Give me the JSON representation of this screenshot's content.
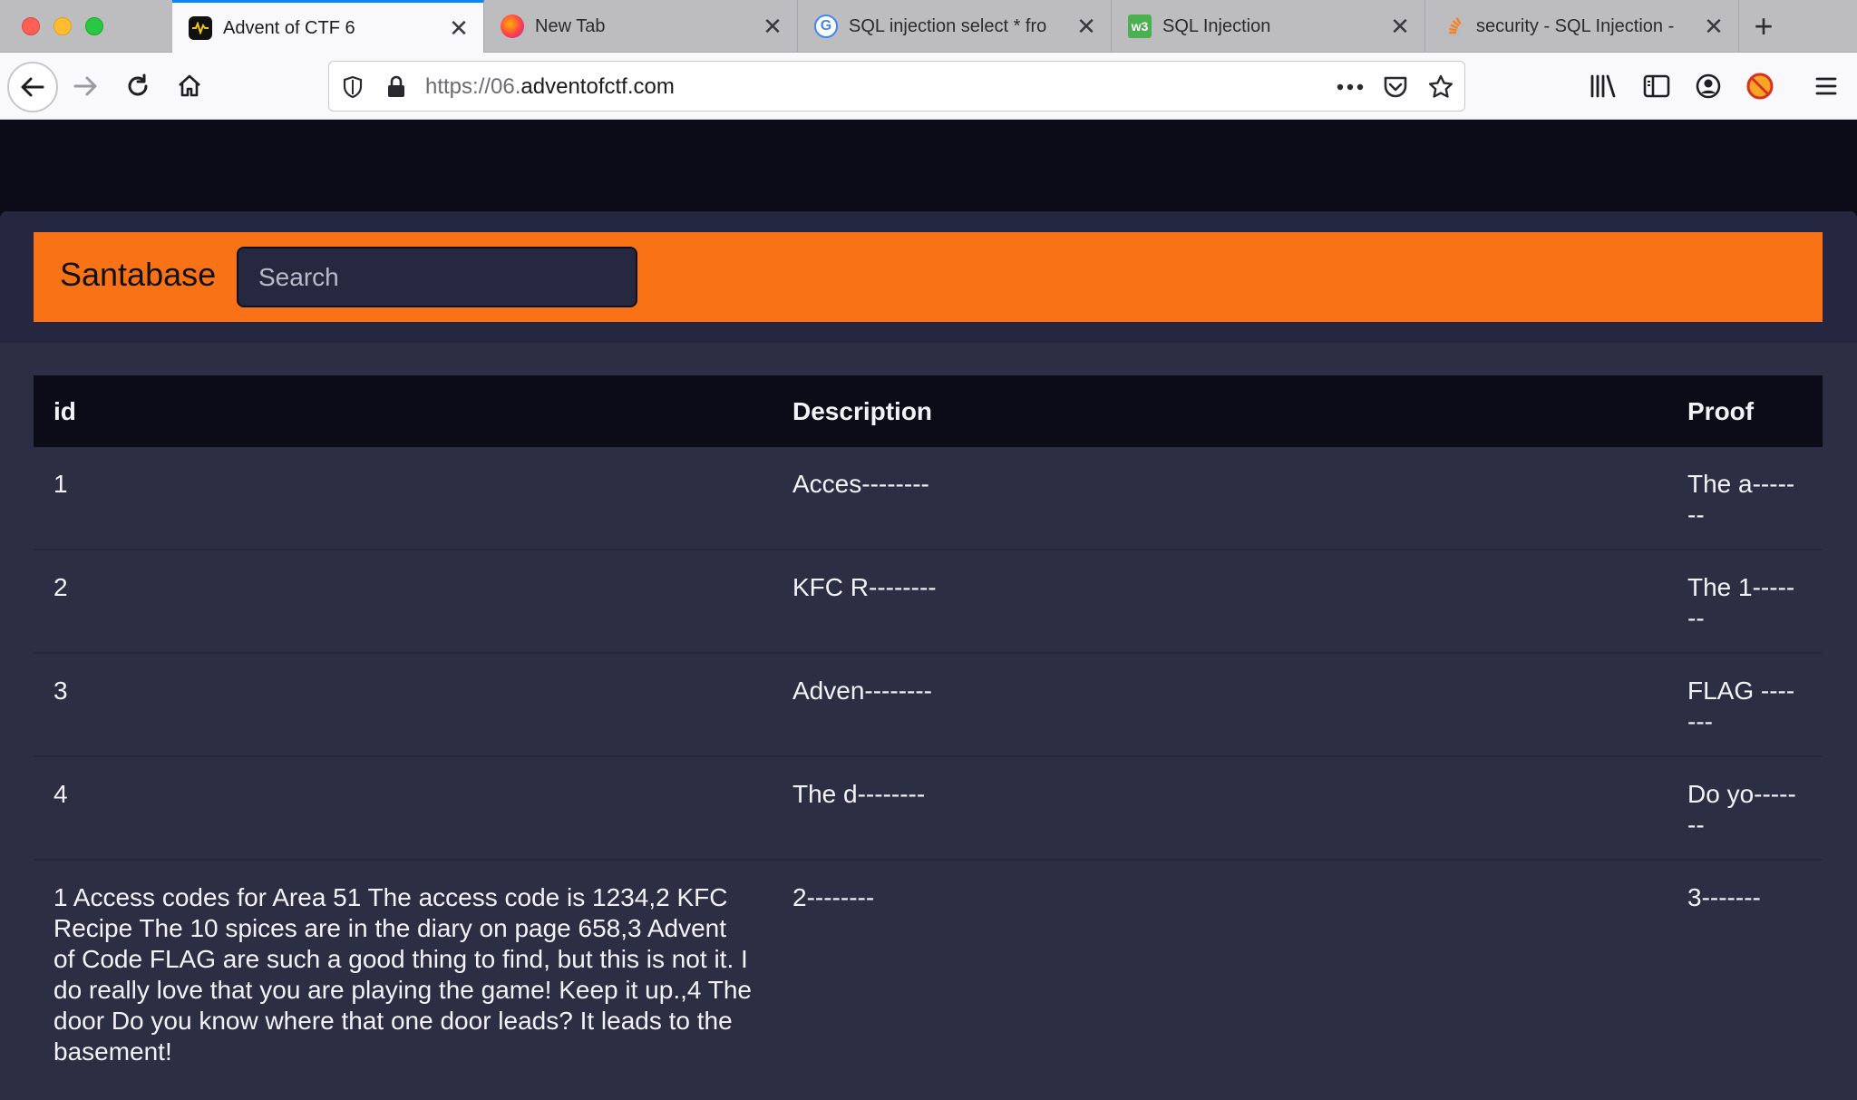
{
  "browser": {
    "tabs": [
      {
        "title": "Advent of CTF 6",
        "favicon": "adventofctf-favicon",
        "active": true
      },
      {
        "title": "New Tab",
        "favicon": "firefox-favicon",
        "active": false
      },
      {
        "title": "SQL injection select * fro",
        "favicon": "google-favicon",
        "active": false
      },
      {
        "title": "SQL Injection",
        "favicon": "w3schools-favicon",
        "active": false
      },
      {
        "title": "security - SQL Injection -",
        "favicon": "stackoverflow-favicon",
        "active": false
      }
    ],
    "url_scheme": "https://06.",
    "url_host": "adventofctf.com"
  },
  "app": {
    "brand": "Santabase",
    "search_placeholder": "Search",
    "accent_color": "#f97316"
  },
  "table": {
    "headers": [
      "id",
      "Description",
      "Proof"
    ],
    "rows": [
      {
        "id": "1",
        "description": "Acces--------",
        "proof": "The a-------"
      },
      {
        "id": "2",
        "description": "KFC R--------",
        "proof": "The 1-------"
      },
      {
        "id": "3",
        "description": "Adven--------",
        "proof": "FLAG -------"
      },
      {
        "id": "4",
        "description": "The d--------",
        "proof": "Do yo-------"
      },
      {
        "id": "1 Access codes for Area 51 The access code is 1234,2 KFC Recipe The 10 spices are in the diary on page 658,3 Advent of Code FLAG are such a good thing to find, but this is not it. I do really love that you are playing the game! Keep it up.,4 The door Do you know where that one door leads? It leads to the basement!",
        "description": "2--------",
        "proof": "3-------"
      }
    ]
  }
}
